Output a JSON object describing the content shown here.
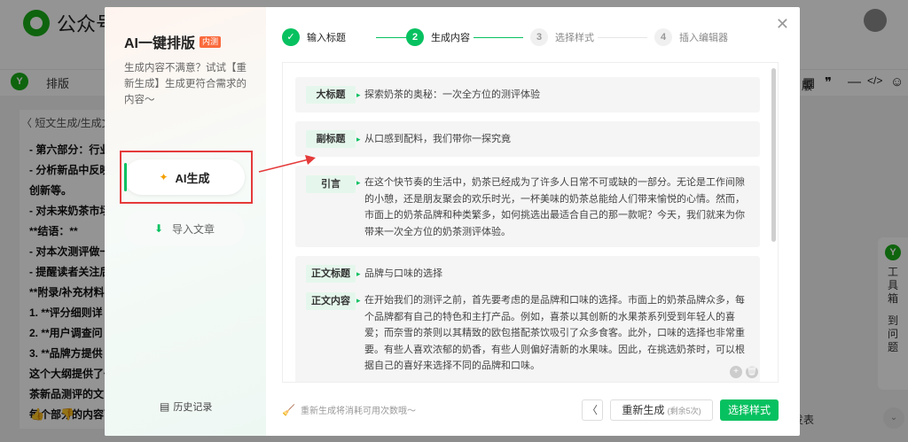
{
  "background": {
    "logo_text": "公众号",
    "toolbar_item": "排版",
    "toolbar_icons": [
      "▦",
      "❞",
      "—",
      "</>",
      "☺"
    ],
    "back_link": "〈 短文生成/生成文",
    "side_right": "版",
    "editor_lines": [
      "- 第六部分：行业",
      "- 分析新品中反映",
      "创新等。",
      "- 对未来奶茶市场",
      "**结语：**",
      "- 对本次测评做一",
      "- 提醒读者关注后",
      "**附录/补充材料",
      "1. **评分细则详",
      "2. **用户调查问",
      "3. **品牌方提供",
      "这个大纲提供了一",
      "茶新品测评的文",
      "每个部分的内容可"
    ],
    "right_tools": {
      "icon": "Y",
      "label": "工具箱",
      "label2": "到问题"
    },
    "bottom_btn": "发表"
  },
  "modal": {
    "title": "AI一键排版",
    "badge": "内测",
    "description": "生成内容不满意？试试【重新生成】生成更符合需求的内容～",
    "nav": {
      "ai": "AI生成",
      "import": "导入文章"
    },
    "history": "历史记录",
    "steps": [
      {
        "num": "✓",
        "label": "输入标题",
        "state": "done"
      },
      {
        "num": "2",
        "label": "生成内容",
        "state": "active"
      },
      {
        "num": "3",
        "label": "选择样式",
        "state": "todo"
      },
      {
        "num": "4",
        "label": "插入编辑器",
        "state": "todo"
      }
    ],
    "content": {
      "headline": {
        "tag": "大标题",
        "text": "探索奶茶的奥秘：一次全方位的测评体验"
      },
      "subhead": {
        "tag": "副标题",
        "text": "从口感到配料，我们带你一探究竟"
      },
      "intro": {
        "tag": "引言",
        "text": "在这个快节奏的生活中，奶茶已经成为了许多人日常不可或缺的一部分。无论是工作间隙的小憩，还是朋友聚会的欢乐时光，一杯美味的奶茶总能给人们带来愉悦的心情。然而，市面上的奶茶品牌和种类繁多，如何挑选出最适合自己的那一款呢？今天，我们就来为你带来一次全方位的奶茶测评体验。"
      },
      "body_title": {
        "tag": "正文标题",
        "text": "品牌与口味的选择"
      },
      "body_content": {
        "tag": "正文内容",
        "text": "在开始我们的测评之前，首先要考虑的是品牌和口味的选择。市面上的奶茶品牌众多，每个品牌都有自己的特色和主打产品。例如，喜茶以其创新的水果茶系列受到年轻人的喜爱；而奈雪的茶则以其精致的欧包搭配茶饮吸引了众多食客。此外，口味的选择也非常重要。有些人喜欢浓郁的奶香，有些人则偏好清新的水果味。因此，在挑选奶茶时，可以根据自己的喜好来选择不同的品牌和口味。"
      }
    },
    "footer": {
      "note": "重新生成将消耗可用次数哦～",
      "regen": "重新生成",
      "regen_remaining": "(剩余5次)",
      "next": "选择样式",
      "prev": "〈"
    }
  },
  "colors": {
    "accent": "#07c160",
    "highlight_box": "#e53a3a",
    "badge": "#fa6a3c"
  }
}
